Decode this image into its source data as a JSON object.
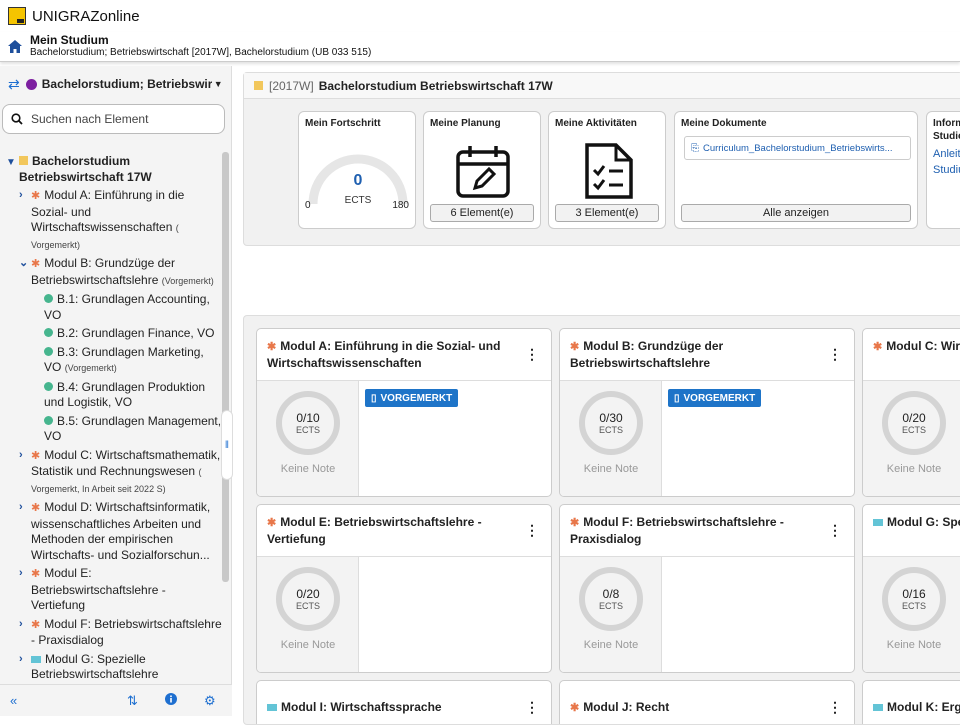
{
  "app": {
    "title": "UNIGRAZonline"
  },
  "context": {
    "title": "Mein Studium",
    "subtitle": "Bachelorstudium; Betriebswirtschaft [2017W], Bachelorstudium (UB 033 515)"
  },
  "sidebar": {
    "selector": "Bachelorstudium; Betriebswirtsch",
    "search_placeholder": "Suchen nach Element",
    "root": "Bachelorstudium Betriebswirtschaft 17W",
    "modules": [
      {
        "label": "Modul A: Einführung in die Sozial- und Wirtschaftswissenschaften",
        "note": "( Vorgemerkt)"
      },
      {
        "label": "Modul B: Grundzüge der Betriebswirtschaftslehre",
        "note": "(Vorgemerkt)"
      },
      {
        "label": "Modul C: Wirtschaftsmathematik, Statistik und Rechnungswesen",
        "note": "( Vorgemerkt, In Arbeit seit 2022 S)"
      },
      {
        "label": "Modul D: Wirtschaftsinformatik, wissenschaftliches Arbeiten und Methoden der empirischen Wirtschafts- und Sozialforschun...",
        "note": ""
      },
      {
        "label": "Modul E: Betriebswirtschaftslehre - Vertiefung",
        "note": ""
      },
      {
        "label": "Modul F: Betriebswirtschaftslehre - Praxisdialog",
        "note": ""
      },
      {
        "label": "Modul G: Spezielle Betriebswirtschaftslehre",
        "note": ""
      }
    ],
    "submodules": [
      {
        "label": "B.1: Grundlagen Accounting, VO",
        "note": ""
      },
      {
        "label": "B.2: Grundlagen Finance, VO",
        "note": ""
      },
      {
        "label": "B.3: Grundlagen Marketing, VO",
        "note": "(Vorgemerkt)"
      },
      {
        "label": "B.4: Grundlagen Produktion und Logistik, VO",
        "note": ""
      },
      {
        "label": "B.5: Grundlagen Management, VO",
        "note": ""
      }
    ]
  },
  "panel": {
    "year": "[2017W]",
    "title": "Bachelorstudium Betriebswirtschaft 17W",
    "fortschritt": {
      "title": "Mein Fortschritt",
      "value": "0",
      "unit": "ECTS",
      "min": "0",
      "max": "180"
    },
    "planung": {
      "title": "Meine Planung",
      "button": "6 Element(e)"
    },
    "aktivitaeten": {
      "title": "Meine Aktivitäten",
      "button": "3 Element(e)"
    },
    "dokumente": {
      "title": "Meine Dokumente",
      "file": "Curriculum_Bachelorstudium_Betriebswirts...",
      "button": "Alle anzeigen"
    },
    "info": {
      "title1": "Inform",
      "title2": "Studie",
      "link1": "Anleit",
      "link2": "Studiu"
    }
  },
  "cards": [
    {
      "title": "Modul A: Einführung in die Sozial- und Wirtschaftswissenschaften",
      "progress": "0/10",
      "unit": "ECTS",
      "grade": "Keine Note",
      "badge": "VORGEMERKT",
      "icon": "star"
    },
    {
      "title": "Modul B: Grundzüge der Betriebswirtschaftslehre",
      "progress": "0/30",
      "unit": "ECTS",
      "grade": "Keine Note",
      "badge": "VORGEMERKT",
      "icon": "star"
    },
    {
      "title": "Modul C: Wirts und Rechnungsw",
      "progress": "0/20",
      "unit": "ECTS",
      "grade": "Keine Note",
      "badge": "",
      "icon": "star"
    },
    {
      "title": "Modul E: Betriebswirtschaftslehre - Vertiefung",
      "progress": "0/20",
      "unit": "ECTS",
      "grade": "Keine Note",
      "badge": "",
      "icon": "star"
    },
    {
      "title": "Modul F: Betriebswirtschaftslehre - Praxisdialog",
      "progress": "0/8",
      "unit": "ECTS",
      "grade": "Keine Note",
      "badge": "",
      "icon": "star"
    },
    {
      "title": "Modul G: Spez",
      "progress": "0/16",
      "unit": "ECTS",
      "grade": "Keine Note",
      "badge": "",
      "icon": "teal-square"
    },
    {
      "title": "Modul I: Wirtschaftssprache",
      "icon": "teal-square"
    },
    {
      "title": "Modul J: Recht",
      "icon": "star"
    },
    {
      "title": "Modul K: Ergän",
      "icon": "teal-square"
    }
  ]
}
